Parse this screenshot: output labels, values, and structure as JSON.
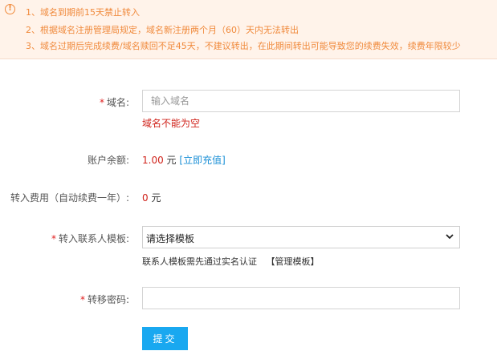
{
  "notice": {
    "icon": "exclamation-circle-icon",
    "lines": [
      "1、域名到期前15天禁止转入",
      "2、根据域名注册管理局规定，域名新注册两个月（60）天内无法转出",
      "3、域名过期后完成续费/域名赎回不足45天，不建议转出，在此期间转出可能导致您的续费失效，续费年限较少"
    ]
  },
  "form": {
    "domain": {
      "required": "*",
      "label": "域名:",
      "placeholder": "输入域名",
      "error": "域名不能为空"
    },
    "balance": {
      "label": "账户余额:",
      "amount": "1.00",
      "unit": "元",
      "recharge_link": "[立即充值]"
    },
    "fee": {
      "label": "转入费用（自动续费一年）:",
      "amount": "0",
      "unit": "元"
    },
    "template": {
      "required": "*",
      "label": "转入联系人模板:",
      "selected": "请选择模板",
      "hint": "联系人模板需先通过实名认证",
      "manage_link": "【管理模板】"
    },
    "password": {
      "required": "*",
      "label": "转移密码:",
      "placeholder": ""
    },
    "submit_label": "提交"
  }
}
